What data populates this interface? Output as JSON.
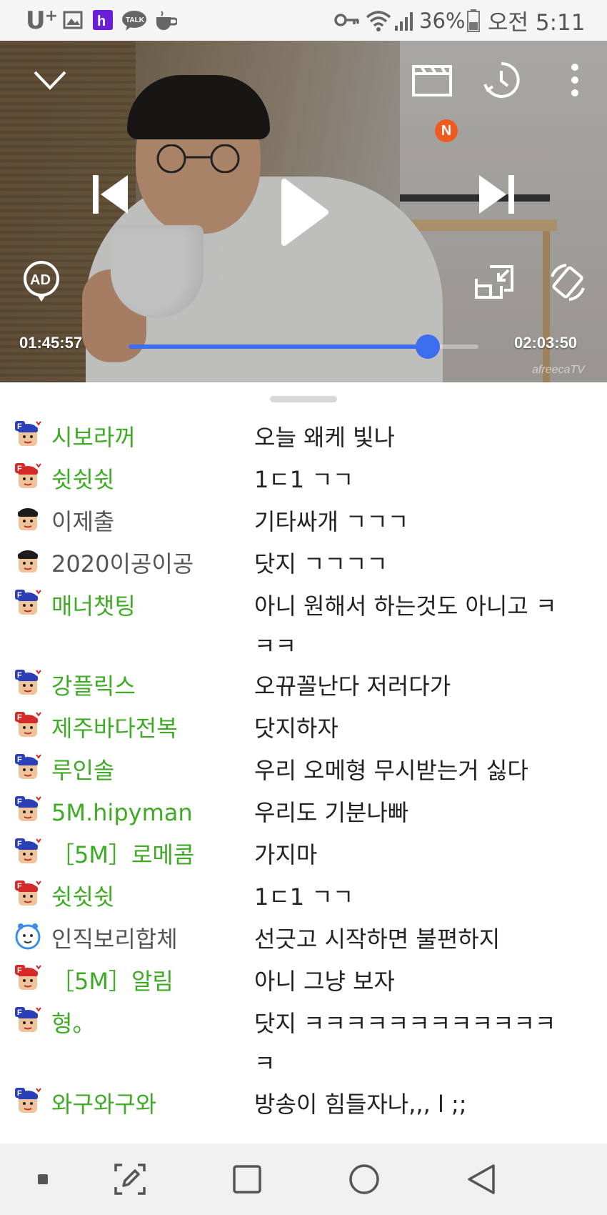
{
  "status_bar": {
    "carrier": "U",
    "carrier_plus": "+",
    "notification_icons": [
      "gallery-icon",
      "hi-app-icon",
      "kakaotalk-icon",
      "coffee-icon"
    ],
    "system_icons": [
      "key-icon",
      "wifi-icon",
      "signal-icon",
      "battery-icon"
    ],
    "battery_percent": "36%",
    "time": "오전 5:11"
  },
  "player": {
    "current_time": "01:45:57",
    "total_time": "02:03:50",
    "progress": 0.8545,
    "badge": "N",
    "ad_label": "AD",
    "watermark": "afreecaTV",
    "accent_color": "#3d6ef0"
  },
  "chat": {
    "messages": [
      {
        "nick": "시보라꺼",
        "text": "오늘 왜케 빛나",
        "avatar": "fan-blue",
        "nick_color": "green"
      },
      {
        "nick": "쉿쉿쉿",
        "text": "1ㄷ1 ㄱㄱ",
        "avatar": "fan-red",
        "nick_color": "green"
      },
      {
        "nick": "이제출",
        "text": "기타싸개 ㄱㄱㄱ",
        "avatar": "default",
        "nick_color": "gray"
      },
      {
        "nick": "2020이공이공",
        "text": "닷지 ㄱㄱㄱㄱ",
        "avatar": "default",
        "nick_color": "gray"
      },
      {
        "nick": "매너챗팅",
        "text": "아니 원해서 하는것도 아니고 ㅋㅋㅋ",
        "avatar": "fan-blue",
        "nick_color": "green"
      },
      {
        "nick": "강플릭스",
        "text": "오뀨꼴난다 저러다가",
        "avatar": "fan-blue",
        "nick_color": "green"
      },
      {
        "nick": "제주바다전복",
        "text": "닷지하자",
        "avatar": "fan-red",
        "nick_color": "green"
      },
      {
        "nick": "루인솔",
        "text": "우리 오메형 무시받는거 싫다",
        "avatar": "fan-blue",
        "nick_color": "green"
      },
      {
        "nick": "5M.hipyman",
        "text": "우리도 기분나빠",
        "avatar": "fan-blue",
        "nick_color": "green"
      },
      {
        "nick": "［5M］로메콤",
        "text": "가지마",
        "avatar": "fan-blue",
        "nick_color": "green"
      },
      {
        "nick": "쉿쉿쉿",
        "text": "1ㄷ1 ㄱㄱ",
        "avatar": "fan-red",
        "nick_color": "green"
      },
      {
        "nick": "인직보리합체",
        "text": "선긋고 시작하면 불편하지",
        "avatar": "clock",
        "nick_color": "gray"
      },
      {
        "nick": "［5M］알림",
        "text": "아니 그냥 보자",
        "avatar": "fan-red",
        "nick_color": "green"
      },
      {
        "nick": "형。",
        "text": "닷지 ㅋㅋㅋㅋㅋㅋㅋㅋㅋㅋㅋㅋㅋ",
        "avatar": "fan-blue",
        "nick_color": "green"
      },
      {
        "nick": "와구와구와",
        "text": "방송이 힘들자나,,, l ;;",
        "avatar": "fan-blue",
        "nick_color": "green"
      }
    ]
  },
  "nav_bar": {
    "buttons": [
      "recent-dot-icon",
      "capture-icon",
      "overview-icon",
      "home-icon",
      "back-icon"
    ]
  }
}
